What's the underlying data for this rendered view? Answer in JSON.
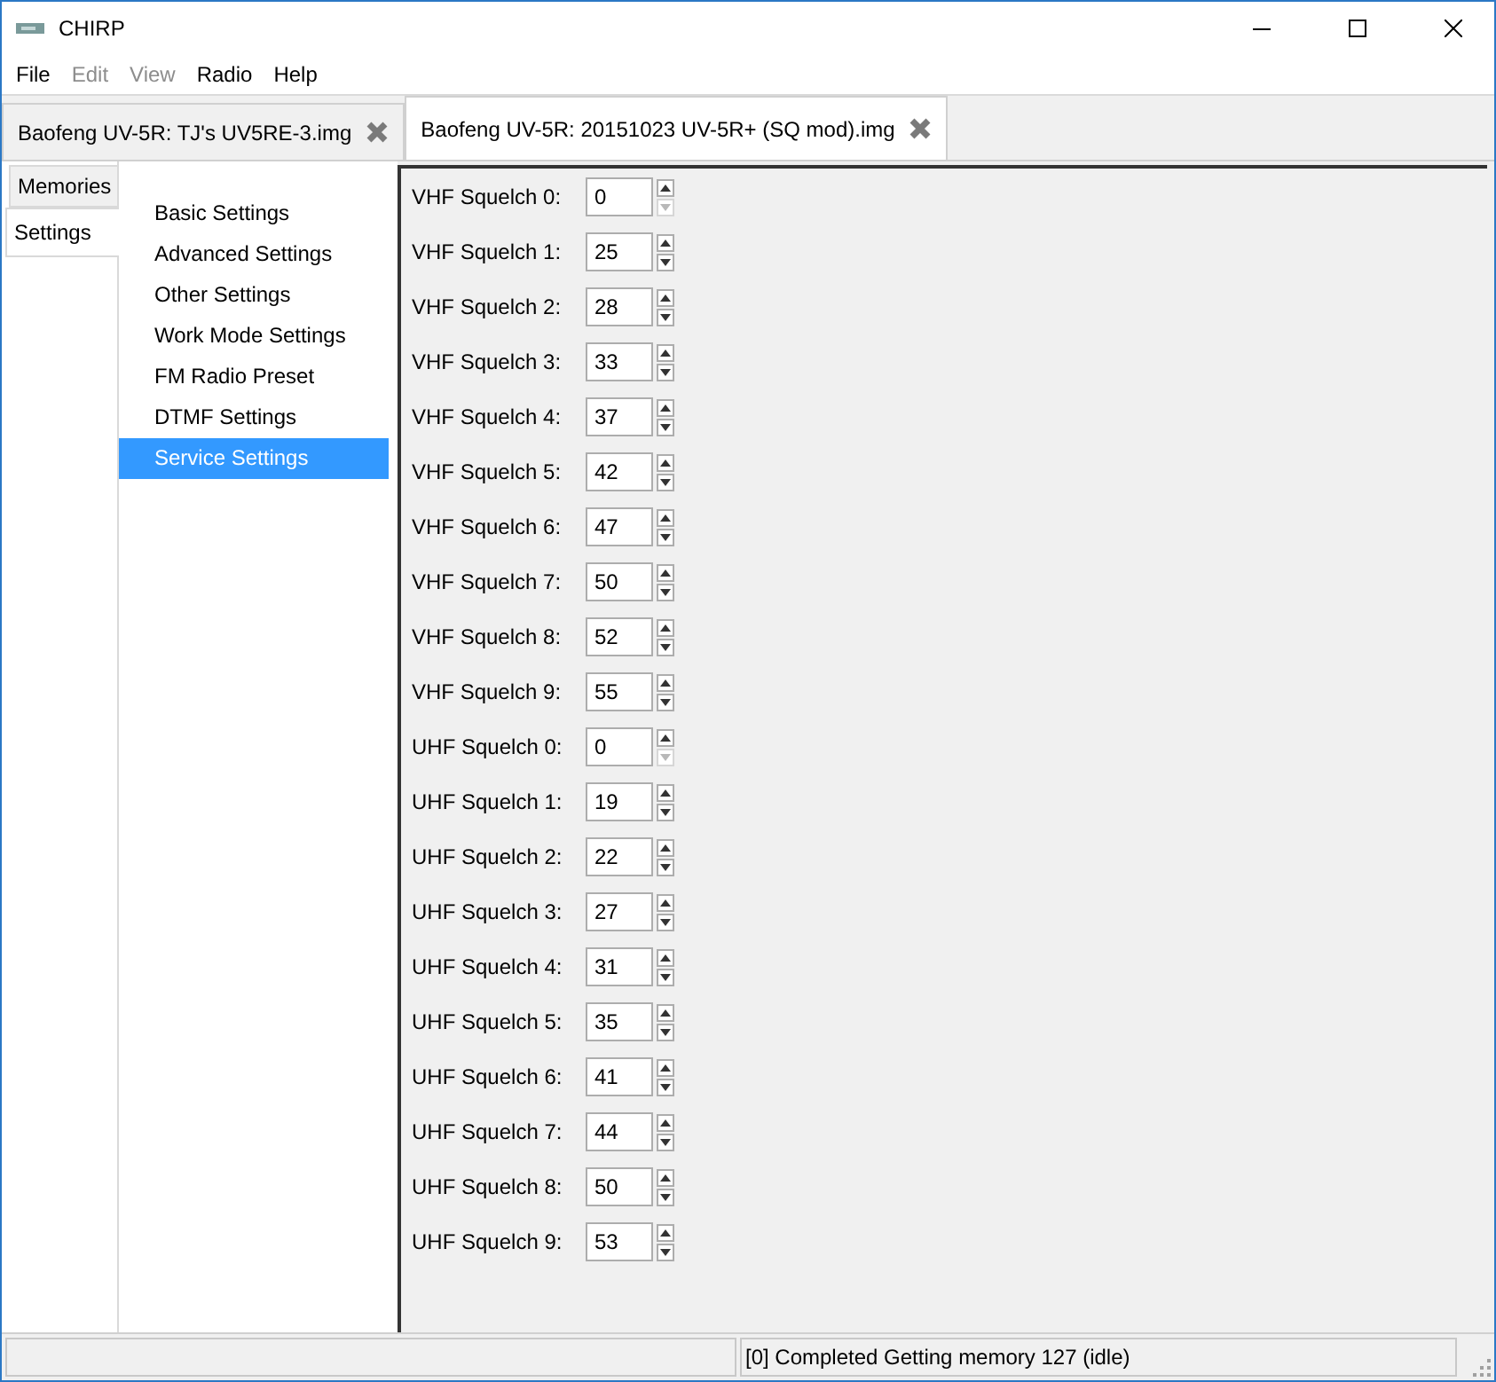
{
  "window": {
    "title": "CHIRP"
  },
  "menu": [
    {
      "label": "File",
      "disabled": false
    },
    {
      "label": "Edit",
      "disabled": true
    },
    {
      "label": "View",
      "disabled": true
    },
    {
      "label": "Radio",
      "disabled": false
    },
    {
      "label": "Help",
      "disabled": false
    }
  ],
  "file_tabs": [
    {
      "label": "Baofeng UV-5R: TJ's UV5RE-3.img",
      "selected": false
    },
    {
      "label": "Baofeng UV-5R: 20151023 UV-5R+ (SQ mod).img",
      "selected": true
    }
  ],
  "side_tabs": [
    {
      "label": "Memories",
      "selected": false
    },
    {
      "label": "Settings",
      "selected": true
    }
  ],
  "settings_groups": [
    {
      "label": "Basic Settings",
      "selected": false
    },
    {
      "label": "Advanced Settings",
      "selected": false
    },
    {
      "label": "Other Settings",
      "selected": false
    },
    {
      "label": "Work Mode Settings",
      "selected": false
    },
    {
      "label": "FM Radio Preset",
      "selected": false
    },
    {
      "label": "DTMF Settings",
      "selected": false
    },
    {
      "label": "Service Settings",
      "selected": true
    }
  ],
  "fields": [
    {
      "label": "VHF Squelch 0:",
      "value": "0",
      "down_disabled": true
    },
    {
      "label": "VHF Squelch 1:",
      "value": "25",
      "down_disabled": false
    },
    {
      "label": "VHF Squelch 2:",
      "value": "28",
      "down_disabled": false
    },
    {
      "label": "VHF Squelch 3:",
      "value": "33",
      "down_disabled": false
    },
    {
      "label": "VHF Squelch 4:",
      "value": "37",
      "down_disabled": false
    },
    {
      "label": "VHF Squelch 5:",
      "value": "42",
      "down_disabled": false
    },
    {
      "label": "VHF Squelch 6:",
      "value": "47",
      "down_disabled": false
    },
    {
      "label": "VHF Squelch 7:",
      "value": "50",
      "down_disabled": false
    },
    {
      "label": "VHF Squelch 8:",
      "value": "52",
      "down_disabled": false
    },
    {
      "label": "VHF Squelch 9:",
      "value": "55",
      "down_disabled": false
    },
    {
      "label": "UHF Squelch 0:",
      "value": "0",
      "down_disabled": true
    },
    {
      "label": "UHF Squelch 1:",
      "value": "19",
      "down_disabled": false
    },
    {
      "label": "UHF Squelch 2:",
      "value": "22",
      "down_disabled": false
    },
    {
      "label": "UHF Squelch 3:",
      "value": "27",
      "down_disabled": false
    },
    {
      "label": "UHF Squelch 4:",
      "value": "31",
      "down_disabled": false
    },
    {
      "label": "UHF Squelch 5:",
      "value": "35",
      "down_disabled": false
    },
    {
      "label": "UHF Squelch 6:",
      "value": "41",
      "down_disabled": false
    },
    {
      "label": "UHF Squelch 7:",
      "value": "44",
      "down_disabled": false
    },
    {
      "label": "UHF Squelch 8:",
      "value": "50",
      "down_disabled": false
    },
    {
      "label": "UHF Squelch 9:",
      "value": "53",
      "down_disabled": false
    }
  ],
  "status_bar": {
    "message": "[0] Completed Getting memory 127 (idle)"
  }
}
